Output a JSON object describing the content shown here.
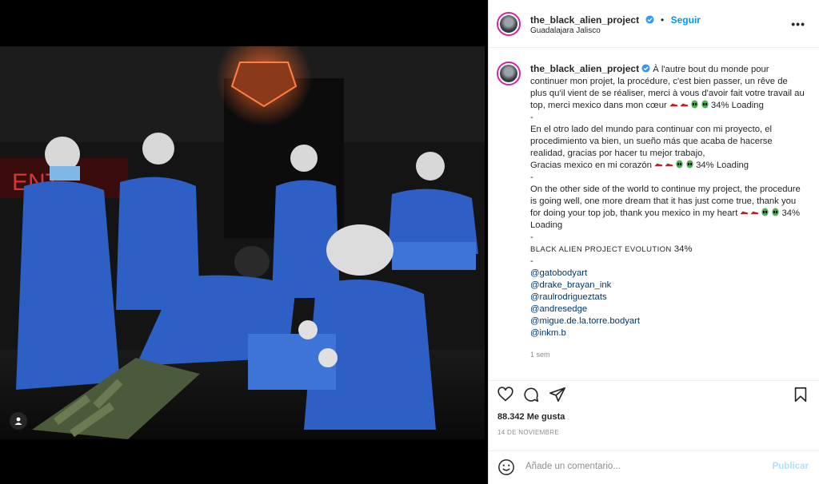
{
  "post": {
    "username": "the_black_alien_project",
    "follow_label": "Seguir",
    "separator": "•",
    "location": "Guadalajara Jalisco",
    "more_label": "•••"
  },
  "caption": {
    "username": "the_black_alien_project",
    "fr_line": "À l'autre  bout du monde pour continuer mon projet, la procédure, c'est bien passer, un rêve de plus qu'il vient de se réaliser, merci à vous d'avoir fait votre travail au top, merci mexico dans mon cœur",
    "fr_suffix": "34% Loading",
    "dash1": "-",
    "es_line": "En el otro lado del mundo para continuar con mi proyecto, el procedimiento va bien, un sueño más que acaba de hacerse realidad, gracias por hacer tu mejor trabajo,",
    "es_line2": "Gracias mexico en mi corazón",
    "es_suffix": "34% Loading",
    "dash2": "-",
    "en_line": "On the other side of the world to continue my project, the procedure is going well, one more dream that it has just come true, thank you for doing your top job, thank you mexico in my heart",
    "en_suffix": "34% Loading",
    "dash3": "-",
    "evolution": "black alien project evolution",
    "evolution_pct": "34%",
    "dash4": "-",
    "mentions": [
      "@gatobodyart",
      "@drake_brayan_ink",
      "@raulrodrigueztats",
      "@andresedge",
      "@migue.de.la.torre.bodyart",
      "@inkm.b"
    ],
    "time_ago": "1 sem"
  },
  "stats": {
    "likes": "88.342 Me gusta",
    "date": "14 DE NOVIEMBRE"
  },
  "comment": {
    "placeholder": "Añade un comentario...",
    "publish_label": "Publicar"
  },
  "colors": {
    "accent": "#0095f6",
    "verified": "#3897f0",
    "mention": "#00376b",
    "gown_blue": "#2e5fc4"
  },
  "icons": [
    "heart-icon",
    "comment-icon",
    "share-icon",
    "bookmark-icon",
    "emoji-icon",
    "verified-icon",
    "user-tag-icon",
    "more-options-icon"
  ]
}
